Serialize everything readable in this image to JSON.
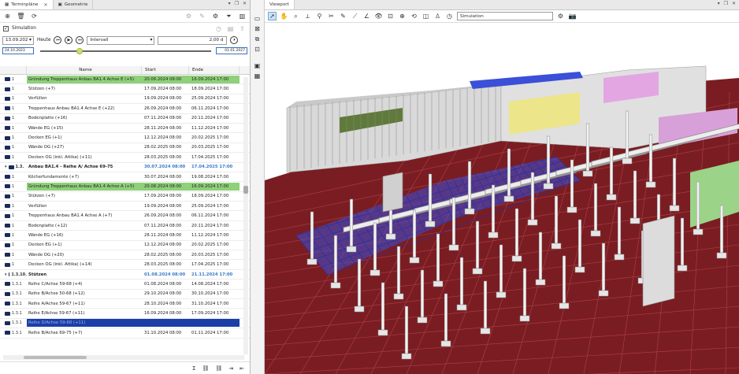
{
  "left_panel": {
    "tabs": [
      {
        "label": "Terminpläne"
      },
      {
        "label": "Geometrie"
      }
    ],
    "simulation_label": "Simulation",
    "date_value": "13.09.202",
    "today_label": "Heute",
    "interval_label": "Intervall",
    "interval_value": "2,00 d",
    "slider_start": "24.10.2023",
    "slider_end": "01.01.2027",
    "columns": {
      "name": "Name",
      "start": "Start",
      "end": "Ende"
    }
  },
  "rows": [
    {
      "num": "1",
      "name": "Gründung Treppenhaus Anbau BA1.4 Achse E (+5)",
      "start": "20.08.2024 08:00",
      "end": "16.09.2024 17:00",
      "style": "green"
    },
    {
      "num": "1",
      "name": "Stützen (+7)",
      "start": "17.09.2024 08:00",
      "end": "18.09.2024 17:00",
      "style": ""
    },
    {
      "num": "1",
      "name": "Verfüllen",
      "start": "19.09.2024 08:00",
      "end": "25.09.2024 17:00",
      "style": ""
    },
    {
      "num": "1",
      "name": "Treppenhaus Anbau BA1.4 Achse E (+22)",
      "start": "26.09.2024 08:00",
      "end": "06.11.2024 17:00",
      "style": ""
    },
    {
      "num": "1",
      "name": "Bodenplatte (+16)",
      "start": "07.11.2024 08:00",
      "end": "20.11.2024 17:00",
      "style": ""
    },
    {
      "num": "1",
      "name": "Wände EG (+15)",
      "start": "28.11.2024 08:00",
      "end": "11.12.2024 17:00",
      "style": ""
    },
    {
      "num": "1",
      "name": "Decken EG (+1)",
      "start": "12.12.2024 08:00",
      "end": "20.02.2025 17:00",
      "style": ""
    },
    {
      "num": "1",
      "name": "Wände OG (+27)",
      "start": "28.02.2025 08:00",
      "end": "20.03.2025 17:00",
      "style": ""
    },
    {
      "num": "1",
      "name": "Decken OG (inkl. Attika) (+11)",
      "start": "28.03.2025 08:00",
      "end": "17.04.2025 17:00",
      "style": ""
    },
    {
      "num": "1.3.",
      "name": "Anbau BA1.4 - Reihe A/ Achse 69-75",
      "start": "30.07.2024 08:00",
      "end": "17.04.2025 17:00",
      "style": "grp"
    },
    {
      "num": "1",
      "name": "Köcherfundamente (+7)",
      "start": "30.07.2024 08:00",
      "end": "19.08.2024 17:00",
      "style": ""
    },
    {
      "num": "1",
      "name": "Gründung Treppenhaus Anbau BA1.4 Achse A (+5)",
      "start": "20.08.2024 08:00",
      "end": "16.09.2024 17:00",
      "style": "green"
    },
    {
      "num": "1",
      "name": "Stützen (+7)",
      "start": "17.09.2024 08:00",
      "end": "18.09.2024 17:00",
      "style": ""
    },
    {
      "num": "1",
      "name": "Verfüllen",
      "start": "19.09.2024 08:00",
      "end": "25.09.2024 17:00",
      "style": ""
    },
    {
      "num": "1",
      "name": "Treppenhaus Anbau BA1.4 Achse A (+7)",
      "start": "26.09.2024 08:00",
      "end": "06.11.2024 17:00",
      "style": ""
    },
    {
      "num": "1",
      "name": "Bodenplatte (+12)",
      "start": "07.11.2024 08:00",
      "end": "20.11.2024 17:00",
      "style": ""
    },
    {
      "num": "1",
      "name": "Wände EG (+16)",
      "start": "28.11.2024 08:00",
      "end": "11.12.2024 17:00",
      "style": ""
    },
    {
      "num": "1",
      "name": "Decken EG (+1)",
      "start": "12.12.2024 08:00",
      "end": "20.02.2025 17:00",
      "style": ""
    },
    {
      "num": "1",
      "name": "Wände OG (+20)",
      "start": "28.02.2025 08:00",
      "end": "20.03.2025 17:00",
      "style": ""
    },
    {
      "num": "1",
      "name": "Decken OG (inkl. Attika) (+14)",
      "start": "28.03.2025 08:00",
      "end": "17.04.2025 17:00",
      "style": ""
    },
    {
      "num": "1.3.10.",
      "name": "Stützen",
      "start": "01.08.2024 08:00",
      "end": "21.11.2024 17:00",
      "style": "grp"
    },
    {
      "num": "1.3.1",
      "name": "Reihe C/Achse 59-68 (+4)",
      "start": "01.08.2024 08:00",
      "end": "14.08.2024 17:00",
      "style": ""
    },
    {
      "num": "1.3.1",
      "name": "Reihe B/Achse 50-68 (+12)",
      "start": "29.10.2024 08:00",
      "end": "30.10.2024 17:00",
      "style": ""
    },
    {
      "num": "1.3.1",
      "name": "Reihe A/Achse 59-67 (+11)",
      "start": "28.10.2024 08:00",
      "end": "31.10.2024 17:00",
      "style": ""
    },
    {
      "num": "1.3.1",
      "name": "Reihe E/Achse 59-67 (+11)",
      "start": "16.09.2024 08:00",
      "end": "17.09.2024 17:00",
      "style": ""
    },
    {
      "num": "1.3.1",
      "name": "Reihe D/Achse 59-68 (+11)",
      "start": "",
      "end": "",
      "style": "blue"
    },
    {
      "num": "1.3.1",
      "name": "Reihe B/Achse 69-75 (+7)",
      "start": "31.10.2024 08:00",
      "end": "01.11.2024 17:00",
      "style": ""
    }
  ],
  "viewport": {
    "tab_label": "Viewport",
    "mode_value": "Simulation"
  },
  "colors": {
    "ground": "#7a1d22",
    "steel_blue": "#3b4fd8",
    "highlight_green": "#8fd07a",
    "selected_blue": "#1a3fa8"
  }
}
